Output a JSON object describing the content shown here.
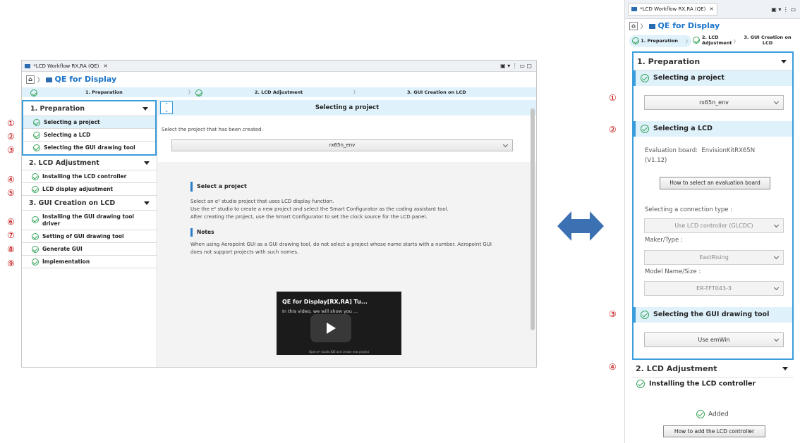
{
  "left_window": {
    "tab_title": "*LCD Workflow RX,RA (QE)",
    "header_title": "QE for Display",
    "steps": [
      "1. Preparation",
      "2. LCD Adjustment",
      "3. GUI Creation on LCD"
    ],
    "sidebar": {
      "sections": [
        {
          "label": "1. Preparation",
          "items": [
            "Selecting a project",
            "Selecting a LCD",
            "Selecting the GUI drawing tool"
          ]
        },
        {
          "label": "2. LCD Adjustment",
          "items": [
            "Installing the LCD controller",
            "LCD display adjustment"
          ]
        },
        {
          "label": "3. GUI Creation on LCD",
          "items": [
            "Installing the GUI drawing tool driver",
            "Setting of GUI drawing tool",
            "Generate GUI",
            "Implementation"
          ]
        }
      ]
    },
    "main": {
      "title": "Selecting a project",
      "prompt": "Select the project that has been created.",
      "project_select": "rx65n_env",
      "help": {
        "heading": "Select a project",
        "para1": "Select an e² studio project that uses LCD display function.",
        "para2": "Use the e² studio to create a new project and select the Smart Configurator as the coding assistant tool.",
        "para3": "After creating the project, use the Smart Configurator to set the clock source for the LCD panel.",
        "notes_heading": "Notes",
        "notes_text": "When using Aeropoint GUI as a GUI drawing tool, do not select a project whose name starts with a number. Aeropoint GUI does not support projects with such names."
      },
      "video": {
        "title": "QE for Display[RX,RA] Tu...",
        "subtitle": "In this video, we will show you ...",
        "caption": "Open e² studio IDE and create new project"
      }
    },
    "markers": [
      "①",
      "②",
      "③",
      "④",
      "⑤",
      "⑥",
      "⑦",
      "⑧",
      "⑨"
    ]
  },
  "right_panel": {
    "tab_title": "*LCD Workflow RX,RA (QE)",
    "header_title": "QE for Display",
    "steps": [
      "1. Preparation",
      "2. LCD\nAdjustment",
      "3. GUI Creation on\nLCD"
    ],
    "section1": {
      "label": "1. Preparation",
      "project": {
        "title": "Selecting a project",
        "value": "rx65n_env"
      },
      "lcd": {
        "title": "Selecting a LCD",
        "eval_board_label": "Evaluation board:",
        "eval_board_value": "EnvisionKitRX65N",
        "eval_board_version": "(V1.12)",
        "how_to_button": "How to select an evaluation board",
        "conn_label": "Selecting a connection type :",
        "conn_value": "Use LCD controller (GLCDC)",
        "maker_label": "Maker/Type :",
        "maker_value": "EastRising",
        "model_label": "Model Name/Size :",
        "model_value": "ER-TFT043-3"
      },
      "gui": {
        "title": "Selecting the GUI drawing tool",
        "value": "Use emWin"
      }
    },
    "section2": {
      "label": "2. LCD Adjustment",
      "item": "Installing the LCD controller",
      "status": "Added",
      "button": "How to add the LCD controller"
    },
    "markers": [
      "①",
      "②",
      "③",
      "④"
    ]
  },
  "colors": {
    "accent": "#1a73c8",
    "step_bg": "#dff1fb",
    "check": "#3aa55c",
    "marker": "#c00000",
    "highlight_border": "#3a9ddc",
    "arrow": "#3b70b3"
  }
}
